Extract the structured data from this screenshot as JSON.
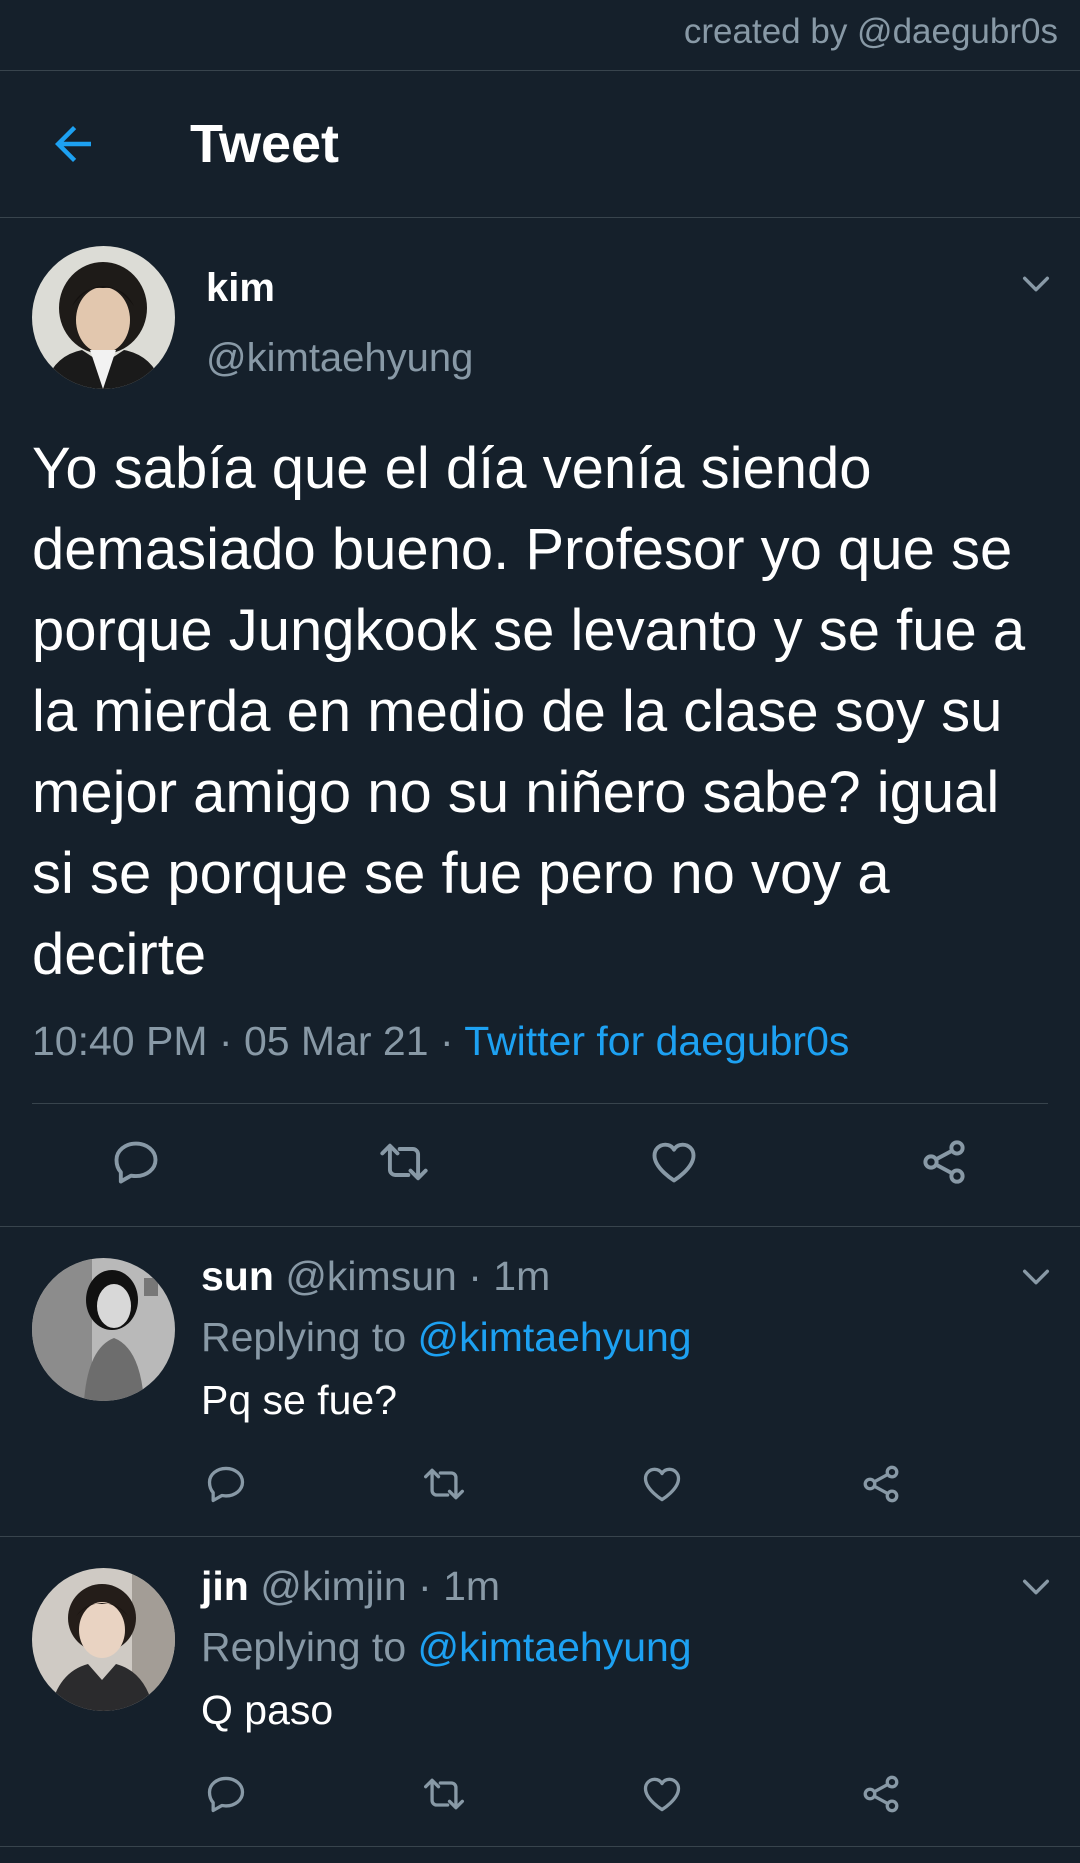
{
  "credit": "created by @daegubr0s",
  "header": {
    "title": "Tweet"
  },
  "tweet": {
    "name": "kim",
    "handle": "@kimtaehyung",
    "text": "Yo sabía que el día venía siendo demasiado bueno. Profesor yo que se porque Jungkook se levanto y se fue a la mierda en medio de la clase soy su mejor amigo no su niñero sabe? igual si se porque se fue pero no voy a decirte",
    "time": "10:40 PM",
    "date": "05 Mar 21",
    "source": "Twitter for daegubr0s",
    "separator": " · "
  },
  "replies": [
    {
      "name": "sun",
      "handle": "@kimsun",
      "time": "1m",
      "replying_prefix": "Replying to ",
      "replying_to": "@kimtaehyung",
      "text": "Pq se fue?"
    },
    {
      "name": "jin",
      "handle": "@kimjin",
      "time": "1m",
      "replying_prefix": "Replying to ",
      "replying_to": "@kimtaehyung",
      "text": "Q paso"
    }
  ],
  "icons": {
    "back": "arrow-left-icon",
    "menu": "chevron-down-icon",
    "reply": "reply-icon",
    "retweet": "retweet-icon",
    "like": "heart-icon",
    "share": "share-icon"
  },
  "colors": {
    "background": "#15202b",
    "accent": "#1da1f2",
    "secondary_text": "#8899a6",
    "divider": "#38444d"
  }
}
